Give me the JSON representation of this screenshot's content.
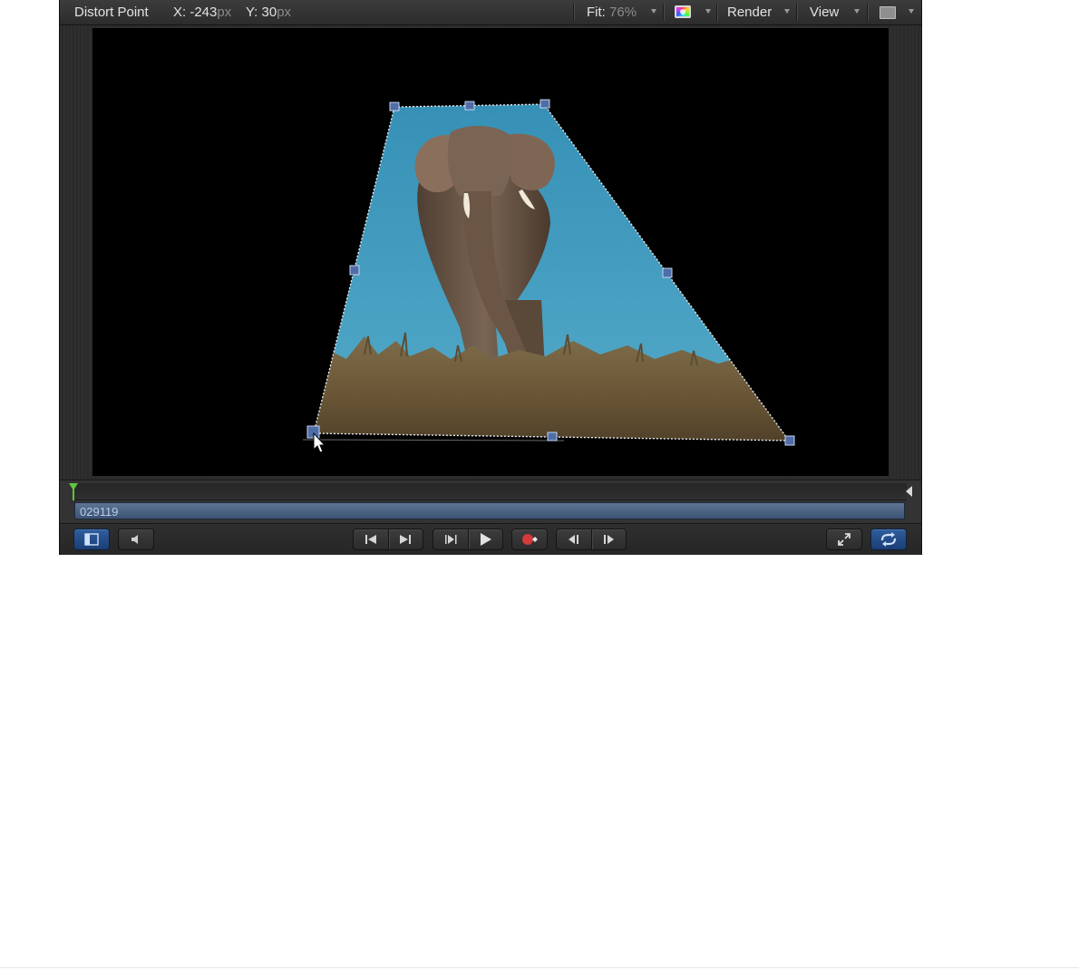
{
  "topbar": {
    "tool_name": "Distort Point",
    "x_label": "X: -243",
    "x_unit": "px",
    "y_label": "Y: 30",
    "y_unit": "px",
    "fit_label": "Fit:",
    "fit_value": "76%",
    "render_label": "Render",
    "view_label": "View"
  },
  "canvas": {
    "image_subject": "elephant",
    "sky_color": "#3f93b7",
    "grass_color": "#6b5a3c",
    "handle_color": "#4f6ea8"
  },
  "timeline": {
    "clip_name": "029119",
    "playhead_color": "#5ec43a"
  },
  "transport": {
    "buttons": [
      {
        "id": "show-hide-timeline",
        "icon": "timeline-panel-icon"
      },
      {
        "id": "audio",
        "icon": "speaker-icon"
      },
      {
        "id": "go-to-start",
        "icon": "skip-to-start-icon"
      },
      {
        "id": "go-to-end",
        "icon": "skip-to-end-icon"
      },
      {
        "id": "play-from-start",
        "icon": "play-from-start-icon"
      },
      {
        "id": "play",
        "icon": "play-icon"
      },
      {
        "id": "record",
        "icon": "record-icon"
      },
      {
        "id": "previous-frame",
        "icon": "previous-frame-icon"
      },
      {
        "id": "next-frame",
        "icon": "next-frame-icon"
      },
      {
        "id": "fullscreen",
        "icon": "fullscreen-icon"
      },
      {
        "id": "loop",
        "icon": "loop-icon"
      }
    ]
  }
}
